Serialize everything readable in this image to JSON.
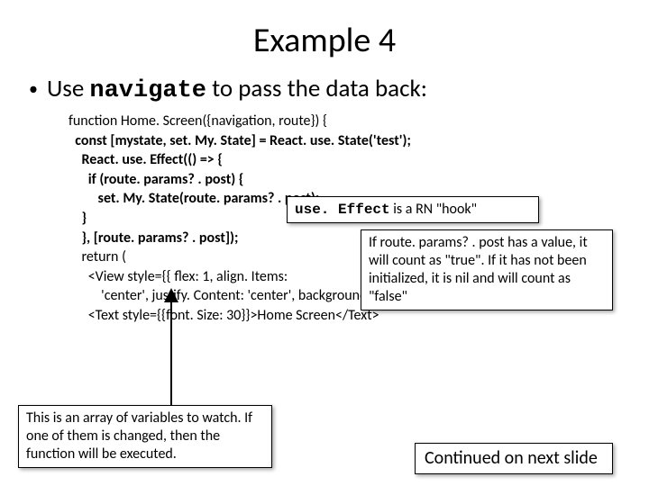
{
  "title": "Example 4",
  "bullet": {
    "pre": "Use ",
    "code": "navigate",
    "post": " to pass the data back:"
  },
  "code": {
    "l1": "function Home. Screen({navigation, route}) {",
    "l2": "  const [mystate, set. My. State] = React. use. State('test');",
    "l3": "",
    "l4": "    React. use. Effect(() => {",
    "l5": "      if (route. params? . post) {",
    "l6": "         set. My. State(route. params? . post);",
    "l7": "    }",
    "l8": "    }, [route. params? . post]);",
    "l9": "    return (",
    "l10": "      <View style={{ flex: 1, align. Items:",
    "l11": "          'center', justify. Content: 'center', background. Color: 'powderblue' }}>",
    "l12": "      <Text style={{font. Size: 30}}>Home Screen</Text>"
  },
  "callouts": {
    "hook_pre": "use. Effect",
    "hook_post": " is a RN \"hook\"",
    "route": "If route. params? . post has a value, it will count as \"true\".  If it has not been initialized, it is nil and will count as \"false\"",
    "watch": "This is an array of variables to watch.  If one of them is changed, then the function will be executed.",
    "continue": "Continued on next slide"
  }
}
